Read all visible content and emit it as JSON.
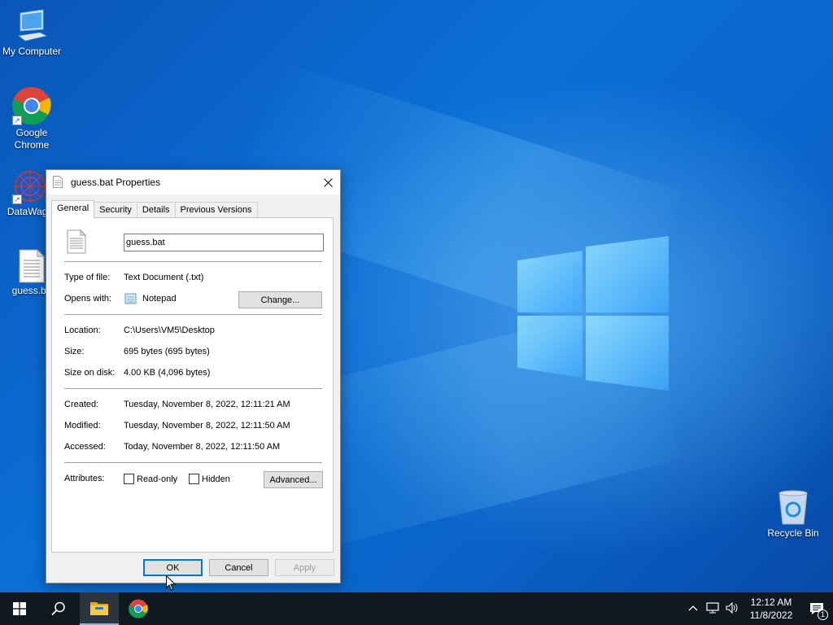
{
  "desktop": {
    "icons": [
      {
        "label": "My Computer"
      },
      {
        "label": "Google Chrome"
      },
      {
        "label": "DataWago"
      },
      {
        "label": "guess.ba"
      },
      {
        "label": "Recycle Bin"
      }
    ]
  },
  "dialog": {
    "title": "guess.bat Properties",
    "tabs": [
      "General",
      "Security",
      "Details",
      "Previous Versions"
    ],
    "filename": "guess.bat",
    "type_label": "Type of file:",
    "type_value": "Text Document (.txt)",
    "opens_label": "Opens with:",
    "opens_value": "Notepad",
    "change_button": "Change...",
    "location_label": "Location:",
    "location_value": "C:\\Users\\VM5\\Desktop",
    "size_label": "Size:",
    "size_value": "695 bytes (695 bytes)",
    "size_on_disk_label": "Size on disk:",
    "size_on_disk_value": "4.00 KB (4,096 bytes)",
    "created_label": "Created:",
    "created_value": "Tuesday, November 8, 2022, 12:11:21 AM",
    "modified_label": "Modified:",
    "modified_value": "Tuesday, November 8, 2022, 12:11:50 AM",
    "accessed_label": "Accessed:",
    "accessed_value": "Today, November 8, 2022, 12:11:50 AM",
    "attributes_label": "Attributes:",
    "readonly_label": "Read-only",
    "hidden_label": "Hidden",
    "advanced_button": "Advanced...",
    "ok_button": "OK",
    "cancel_button": "Cancel",
    "apply_button": "Apply"
  },
  "taskbar": {
    "time": "12:12 AM",
    "date": "11/8/2022",
    "notification_count": "1"
  }
}
